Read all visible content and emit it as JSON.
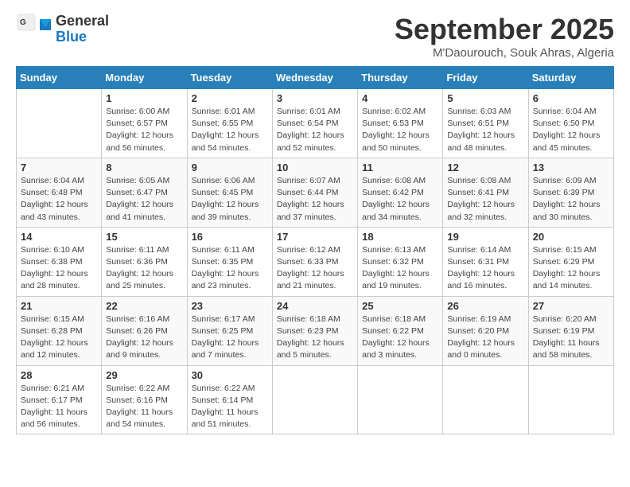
{
  "logo": {
    "part1": "General",
    "part2": "Blue"
  },
  "header": {
    "month": "September 2025",
    "location": "M'Daourouch, Souk Ahras, Algeria"
  },
  "days_of_week": [
    "Sunday",
    "Monday",
    "Tuesday",
    "Wednesday",
    "Thursday",
    "Friday",
    "Saturday"
  ],
  "weeks": [
    [
      {
        "day": "",
        "info": ""
      },
      {
        "day": "1",
        "info": "Sunrise: 6:00 AM\nSunset: 6:57 PM\nDaylight: 12 hours and 56 minutes."
      },
      {
        "day": "2",
        "info": "Sunrise: 6:01 AM\nSunset: 6:55 PM\nDaylight: 12 hours and 54 minutes."
      },
      {
        "day": "3",
        "info": "Sunrise: 6:01 AM\nSunset: 6:54 PM\nDaylight: 12 hours and 52 minutes."
      },
      {
        "day": "4",
        "info": "Sunrise: 6:02 AM\nSunset: 6:53 PM\nDaylight: 12 hours and 50 minutes."
      },
      {
        "day": "5",
        "info": "Sunrise: 6:03 AM\nSunset: 6:51 PM\nDaylight: 12 hours and 48 minutes."
      },
      {
        "day": "6",
        "info": "Sunrise: 6:04 AM\nSunset: 6:50 PM\nDaylight: 12 hours and 45 minutes."
      }
    ],
    [
      {
        "day": "7",
        "info": "Sunrise: 6:04 AM\nSunset: 6:48 PM\nDaylight: 12 hours and 43 minutes."
      },
      {
        "day": "8",
        "info": "Sunrise: 6:05 AM\nSunset: 6:47 PM\nDaylight: 12 hours and 41 minutes."
      },
      {
        "day": "9",
        "info": "Sunrise: 6:06 AM\nSunset: 6:45 PM\nDaylight: 12 hours and 39 minutes."
      },
      {
        "day": "10",
        "info": "Sunrise: 6:07 AM\nSunset: 6:44 PM\nDaylight: 12 hours and 37 minutes."
      },
      {
        "day": "11",
        "info": "Sunrise: 6:08 AM\nSunset: 6:42 PM\nDaylight: 12 hours and 34 minutes."
      },
      {
        "day": "12",
        "info": "Sunrise: 6:08 AM\nSunset: 6:41 PM\nDaylight: 12 hours and 32 minutes."
      },
      {
        "day": "13",
        "info": "Sunrise: 6:09 AM\nSunset: 6:39 PM\nDaylight: 12 hours and 30 minutes."
      }
    ],
    [
      {
        "day": "14",
        "info": "Sunrise: 6:10 AM\nSunset: 6:38 PM\nDaylight: 12 hours and 28 minutes."
      },
      {
        "day": "15",
        "info": "Sunrise: 6:11 AM\nSunset: 6:36 PM\nDaylight: 12 hours and 25 minutes."
      },
      {
        "day": "16",
        "info": "Sunrise: 6:11 AM\nSunset: 6:35 PM\nDaylight: 12 hours and 23 minutes."
      },
      {
        "day": "17",
        "info": "Sunrise: 6:12 AM\nSunset: 6:33 PM\nDaylight: 12 hours and 21 minutes."
      },
      {
        "day": "18",
        "info": "Sunrise: 6:13 AM\nSunset: 6:32 PM\nDaylight: 12 hours and 19 minutes."
      },
      {
        "day": "19",
        "info": "Sunrise: 6:14 AM\nSunset: 6:31 PM\nDaylight: 12 hours and 16 minutes."
      },
      {
        "day": "20",
        "info": "Sunrise: 6:15 AM\nSunset: 6:29 PM\nDaylight: 12 hours and 14 minutes."
      }
    ],
    [
      {
        "day": "21",
        "info": "Sunrise: 6:15 AM\nSunset: 6:28 PM\nDaylight: 12 hours and 12 minutes."
      },
      {
        "day": "22",
        "info": "Sunrise: 6:16 AM\nSunset: 6:26 PM\nDaylight: 12 hours and 9 minutes."
      },
      {
        "day": "23",
        "info": "Sunrise: 6:17 AM\nSunset: 6:25 PM\nDaylight: 12 hours and 7 minutes."
      },
      {
        "day": "24",
        "info": "Sunrise: 6:18 AM\nSunset: 6:23 PM\nDaylight: 12 hours and 5 minutes."
      },
      {
        "day": "25",
        "info": "Sunrise: 6:18 AM\nSunset: 6:22 PM\nDaylight: 12 hours and 3 minutes."
      },
      {
        "day": "26",
        "info": "Sunrise: 6:19 AM\nSunset: 6:20 PM\nDaylight: 12 hours and 0 minutes."
      },
      {
        "day": "27",
        "info": "Sunrise: 6:20 AM\nSunset: 6:19 PM\nDaylight: 11 hours and 58 minutes."
      }
    ],
    [
      {
        "day": "28",
        "info": "Sunrise: 6:21 AM\nSunset: 6:17 PM\nDaylight: 11 hours and 56 minutes."
      },
      {
        "day": "29",
        "info": "Sunrise: 6:22 AM\nSunset: 6:16 PM\nDaylight: 11 hours and 54 minutes."
      },
      {
        "day": "30",
        "info": "Sunrise: 6:22 AM\nSunset: 6:14 PM\nDaylight: 11 hours and 51 minutes."
      },
      {
        "day": "",
        "info": ""
      },
      {
        "day": "",
        "info": ""
      },
      {
        "day": "",
        "info": ""
      },
      {
        "day": "",
        "info": ""
      }
    ]
  ]
}
